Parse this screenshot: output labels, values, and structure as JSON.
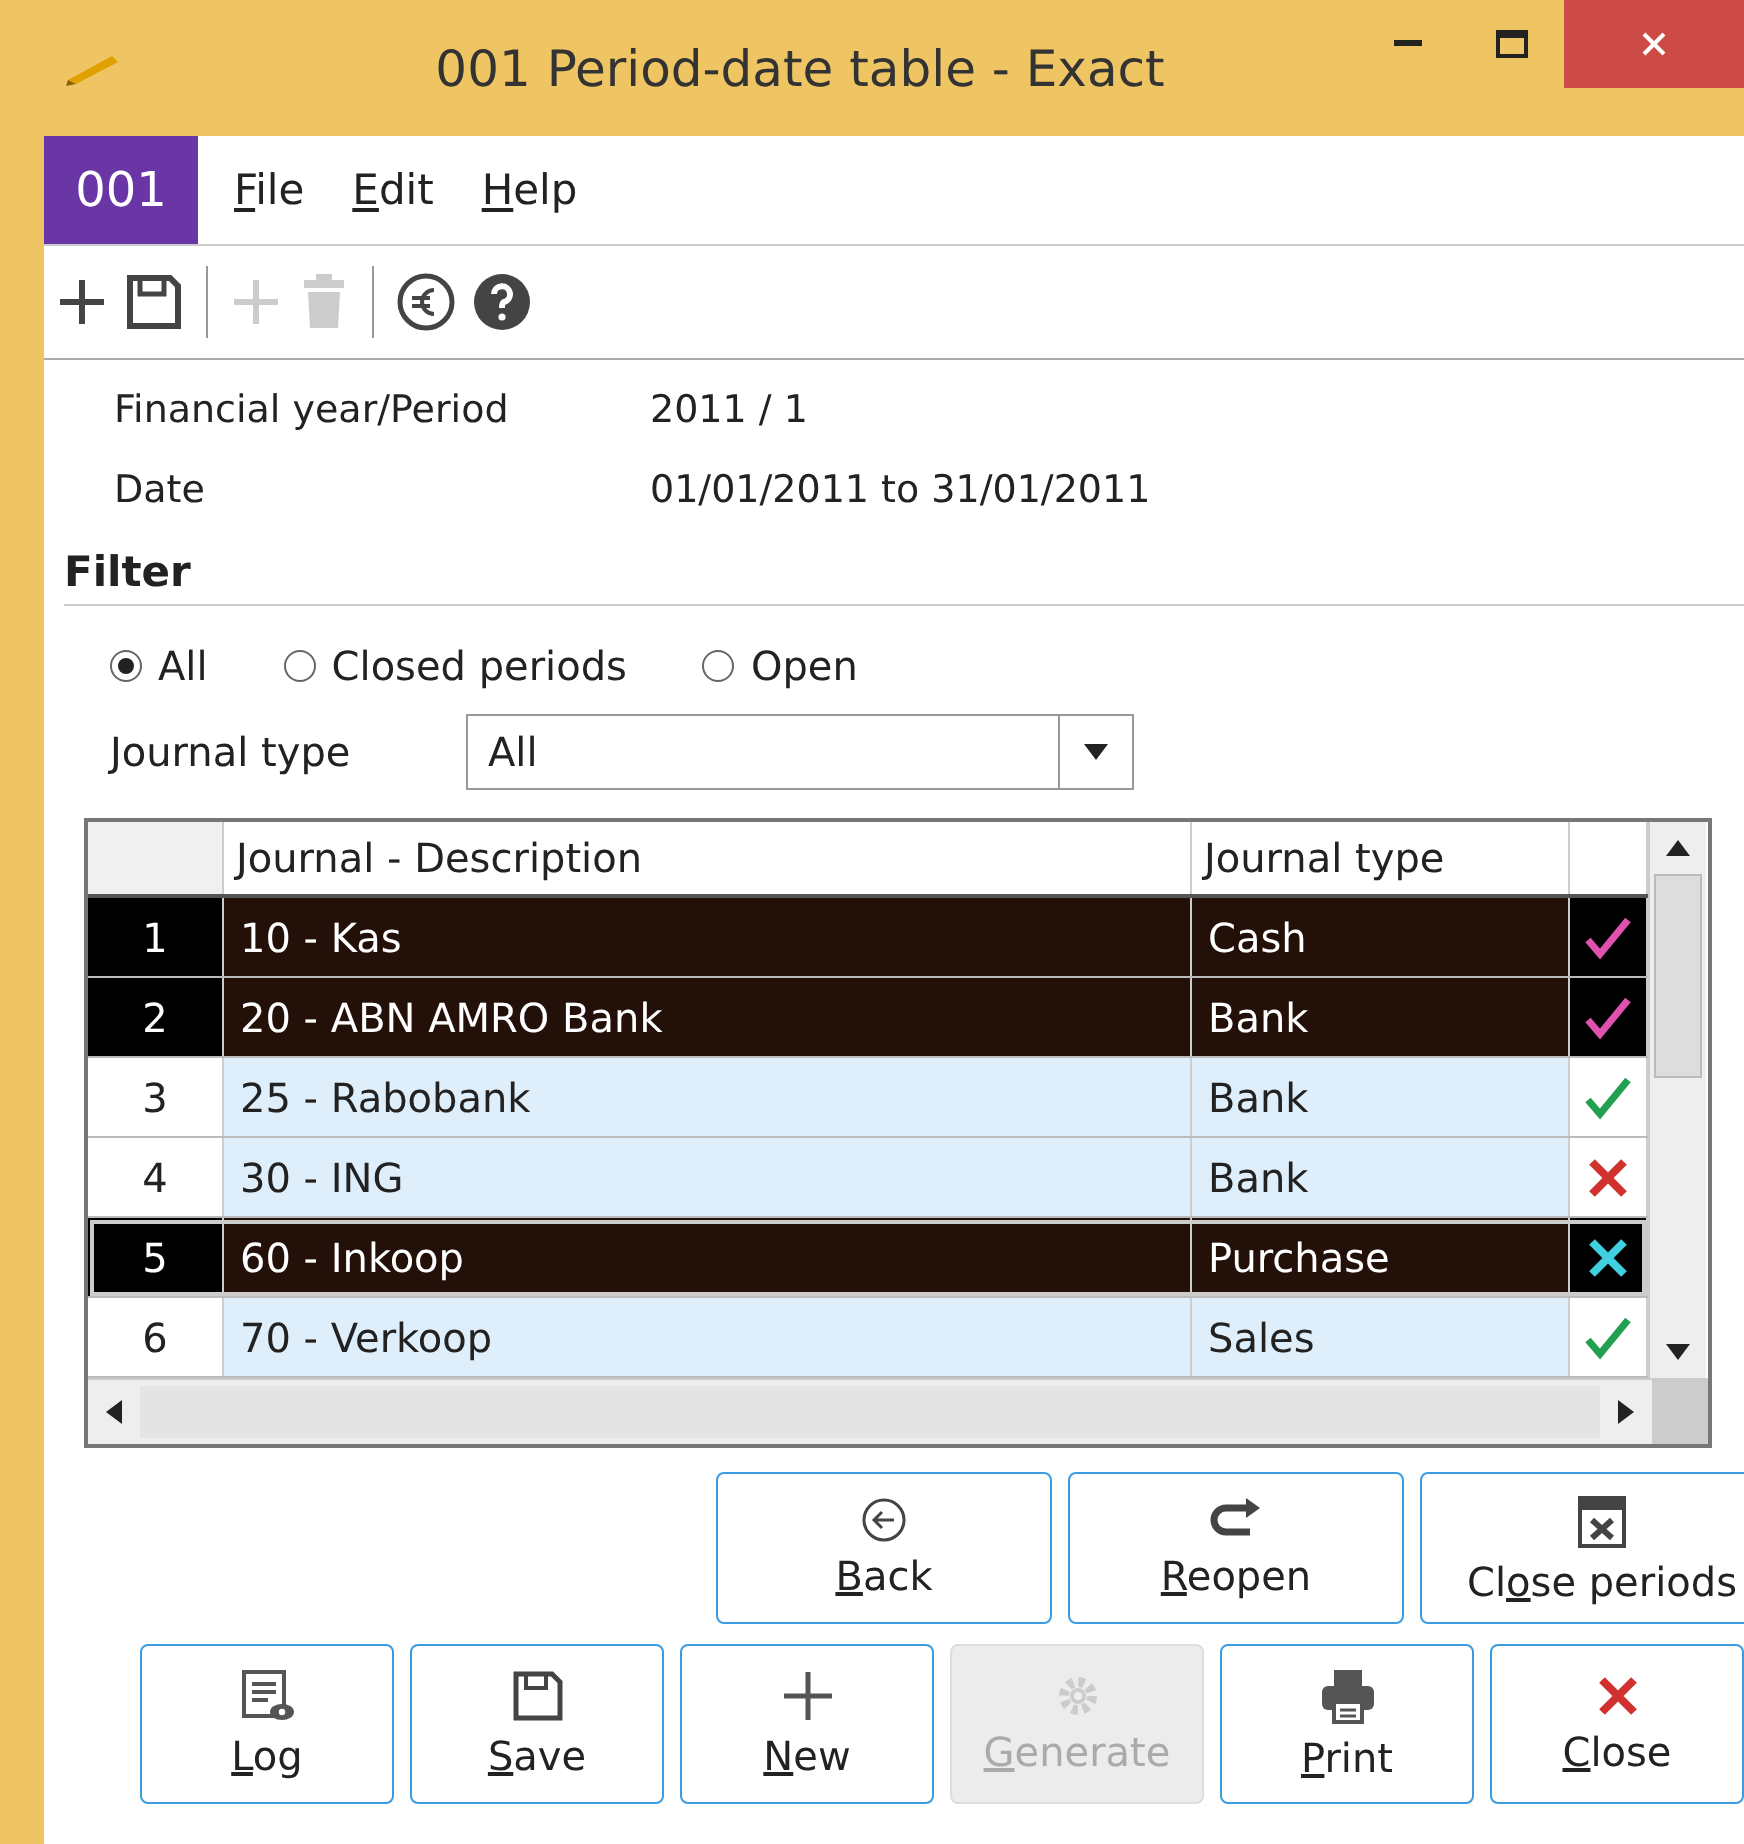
{
  "window": {
    "title": "001 Period-date table - Exact"
  },
  "menu": {
    "badge": "001",
    "items": [
      {
        "label": [
          {
            "text": "F",
            "underlined": true
          },
          {
            "text": "ile",
            "underlined": false
          }
        ]
      },
      {
        "label": [
          {
            "text": "E",
            "underlined": true
          },
          {
            "text": "dit",
            "underlined": false
          }
        ]
      },
      {
        "label": [
          {
            "text": "H",
            "underlined": true
          },
          {
            "text": "elp",
            "underlined": false
          }
        ]
      }
    ]
  },
  "toolbar": [
    {
      "kind": "plus",
      "disabled": false
    },
    {
      "kind": "save",
      "disabled": false
    },
    {
      "kind": "sep"
    },
    {
      "kind": "plus",
      "disabled": true
    },
    {
      "kind": "trash",
      "disabled": true
    },
    {
      "kind": "sep"
    },
    {
      "kind": "euro",
      "disabled": false
    },
    {
      "kind": "help",
      "disabled": false
    }
  ],
  "info": [
    {
      "label": "Financial year/Period",
      "value": "2011 / 1"
    },
    {
      "label": "Date",
      "value": "01/01/2011 to 31/01/2011"
    }
  ],
  "filter": {
    "title": "Filter",
    "options": [
      {
        "label": "All",
        "selected": true
      },
      {
        "label": "Closed periods",
        "selected": false
      },
      {
        "label": "Open",
        "selected": false
      }
    ],
    "journal_type": {
      "label": "Journal type",
      "value": "All"
    }
  },
  "table": {
    "columns": [
      "Journal - Description",
      "Journal type"
    ],
    "rows": [
      {
        "number": "1",
        "description": "10 - Kas",
        "type": "Cash",
        "checked": true,
        "selected": true,
        "focused": false
      },
      {
        "number": "2",
        "description": "20 - ABN AMRO Bank",
        "type": "Bank",
        "checked": true,
        "selected": true,
        "focused": false
      },
      {
        "number": "3",
        "description": "25 - Rabobank",
        "type": "Bank",
        "checked": true,
        "selected": false,
        "focused": false
      },
      {
        "number": "4",
        "description": "30 - ING",
        "type": "Bank",
        "checked": false,
        "selected": false,
        "focused": false
      },
      {
        "number": "5",
        "description": "60 - Inkoop",
        "type": "Purchase",
        "checked": false,
        "selected": true,
        "focused": true
      },
      {
        "number": "6",
        "description": "70 - Verkoop",
        "type": "Sales",
        "checked": true,
        "selected": false,
        "focused": false
      }
    ]
  },
  "action_buttons": [
    {
      "kind": "back",
      "disabled": false,
      "label": [
        {
          "text": "B",
          "underlined": true
        },
        {
          "text": "ack",
          "underlined": false
        }
      ]
    },
    {
      "kind": "reopen",
      "disabled": false,
      "label": [
        {
          "text": "R",
          "underlined": true
        },
        {
          "text": "eopen",
          "underlined": false
        }
      ]
    },
    {
      "kind": "close-periods",
      "disabled": false,
      "label": [
        {
          "text": "Cl",
          "underlined": false
        },
        {
          "text": "o",
          "underlined": true
        },
        {
          "text": "se periods",
          "underlined": false
        }
      ]
    }
  ],
  "bottom_buttons": [
    {
      "kind": "log",
      "disabled": false,
      "label": [
        {
          "text": "L",
          "underlined": true
        },
        {
          "text": "og",
          "underlined": false
        }
      ]
    },
    {
      "kind": "save",
      "disabled": false,
      "label": [
        {
          "text": "S",
          "underlined": true
        },
        {
          "text": "ave",
          "underlined": false
        }
      ]
    },
    {
      "kind": "new",
      "disabled": false,
      "label": [
        {
          "text": "N",
          "underlined": true
        },
        {
          "text": "ew",
          "underlined": false
        }
      ]
    },
    {
      "kind": "generate",
      "disabled": true,
      "label": [
        {
          "text": "G",
          "underlined": true
        },
        {
          "text": "enerate",
          "underlined": false
        }
      ]
    },
    {
      "kind": "print",
      "disabled": false,
      "label": [
        {
          "text": "P",
          "underlined": true
        },
        {
          "text": "rint",
          "underlined": false
        }
      ]
    },
    {
      "kind": "close",
      "disabled": false,
      "label": [
        {
          "text": "C",
          "underlined": true
        },
        {
          "text": "lose",
          "underlined": false
        }
      ]
    }
  ]
}
